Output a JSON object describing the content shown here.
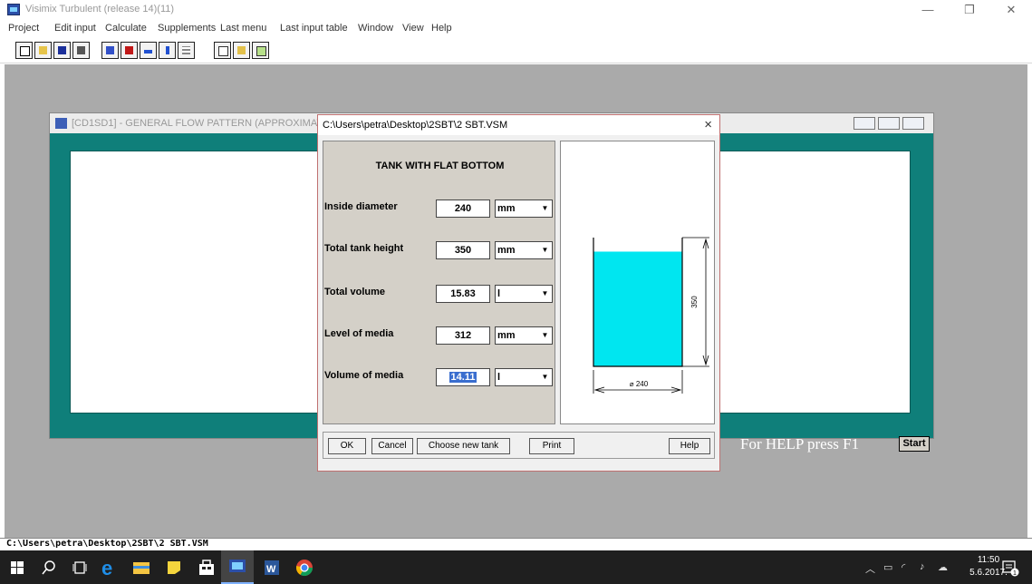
{
  "window": {
    "title": "Visimix Turbulent (release 14)(11)"
  },
  "menu": [
    "Project",
    "Edit input",
    "Calculate",
    "Supplements",
    "Last menu",
    "Last input table",
    "Window",
    "View",
    "Help"
  ],
  "toolbar_icons": [
    "new-icon",
    "open-icon",
    "save-icon",
    "print-icon",
    "tank-icon",
    "baffle-icon",
    "flow-icon",
    "tube-icon",
    "table-icon",
    "tile-icon",
    "arrow-icon",
    "input-table-icon"
  ],
  "child_window": {
    "title": "[CD1SD1] - GENERAL FLOW PATTERN (APPROXIMATE)",
    "start_label": "Start",
    "help_text": "For HELP press F1"
  },
  "dialog": {
    "title": "C:\\Users\\petra\\Desktop\\2SBT\\2 SBT.VSM",
    "close": "×",
    "heading": "TANK WITH FLAT BOTTOM",
    "rows": [
      {
        "label": "Inside diameter",
        "value": "240",
        "unit": "mm"
      },
      {
        "label": "Total tank height",
        "value": "350",
        "unit": "mm"
      },
      {
        "label": "Total volume",
        "value": "15.83",
        "unit": "l"
      },
      {
        "label": "Level of media",
        "value": "312",
        "unit": "mm"
      },
      {
        "label": "Volume of media",
        "value": "14.11",
        "unit": "l"
      }
    ],
    "diagram": {
      "height_label": "350",
      "diameter_label": "⌀ 240",
      "fill_color": "#00e6f0",
      "fill_fraction": 0.891
    },
    "buttons": {
      "ok": "OK",
      "cancel": "Cancel",
      "choose": "Choose new tank",
      "print": "Print",
      "help": "Help"
    }
  },
  "statusbar": {
    "path": "C:\\Users\\petra\\Desktop\\2SBT\\2 SBT.VSM"
  },
  "taskbar": {
    "time": "11:50",
    "date": "5.6.2017.",
    "notifications": "1"
  }
}
